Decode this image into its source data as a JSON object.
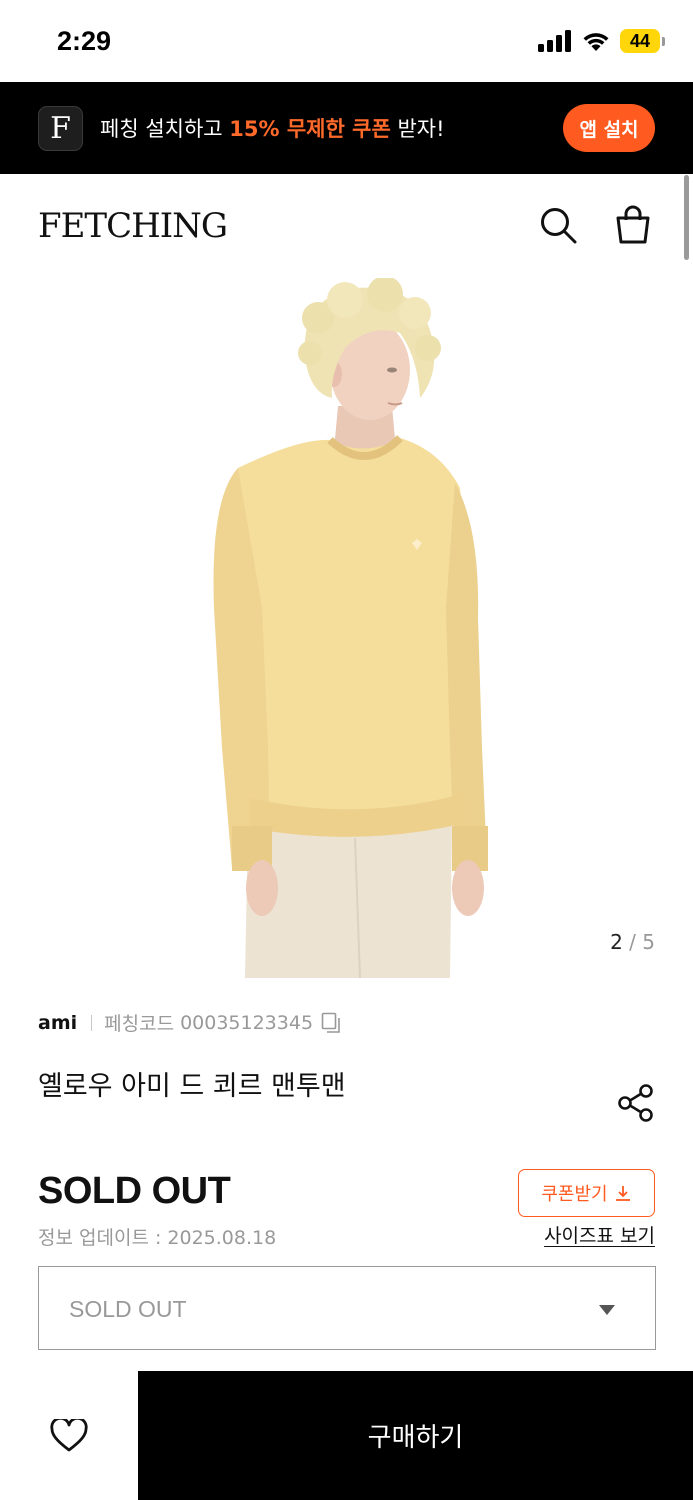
{
  "status_bar": {
    "time": "2:29",
    "battery": "44"
  },
  "promo": {
    "logo_letter": "F",
    "text_before": "페칭 설치하고 ",
    "text_highlight": "15% 무제한 쿠폰",
    "text_after": " 받자!",
    "button_label": "앱 설치",
    "accent_color": "#ff5a1f"
  },
  "header": {
    "logo": "FETCHING",
    "icons": [
      "search-icon",
      "shopping-bag-icon"
    ]
  },
  "gallery": {
    "current": "2",
    "total": "5"
  },
  "product": {
    "brand": "ami",
    "code_label": "페칭코드",
    "code": "00035123345",
    "title": "옐로우 아미 드 쾨르 맨투맨",
    "price": "SOLD OUT",
    "update_info": "정보 업데이트 : 2025.08.18",
    "coupon_label": "쿠폰받기",
    "size_chart_label": "사이즈표 보기"
  },
  "option_select": {
    "value": "SOLD OUT"
  },
  "bottom_bar": {
    "buy_label": "구매하기"
  }
}
